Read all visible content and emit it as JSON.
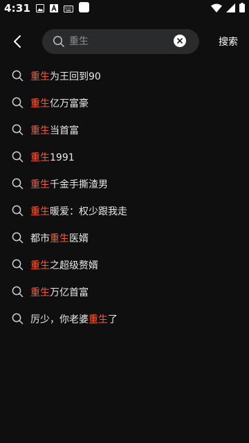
{
  "status_bar": {
    "time": "4:31",
    "icons": [
      "image-icon",
      "text-a-icon",
      "keyboard-icon",
      "app-square-icon",
      "wifi-icon",
      "signal-icon",
      "battery-icon"
    ]
  },
  "header": {
    "back_icon": "chevron-left-icon",
    "search": {
      "value": "重生",
      "placeholder": "重生",
      "icon": "search-icon",
      "clear_icon": "close-icon"
    },
    "search_button_label": "搜索"
  },
  "suggestions": [
    {
      "pre": "",
      "hl": "重生",
      "post": "为王回到90"
    },
    {
      "pre": "",
      "hl": "重生",
      "post": "亿万富豪"
    },
    {
      "pre": "",
      "hl": "重生",
      "post": "当首富"
    },
    {
      "pre": "",
      "hl": "重生",
      "post": "1991"
    },
    {
      "pre": "",
      "hl": "重生",
      "post": "千金手撕渣男"
    },
    {
      "pre": "",
      "hl": "重生",
      "post": "暖爱：权少跟我走"
    },
    {
      "pre": "都市",
      "hl": "重生",
      "post": "医婿"
    },
    {
      "pre": "",
      "hl": "重生",
      "post": "之超级赘婿"
    },
    {
      "pre": "",
      "hl": "重生",
      "post": "万亿首富"
    },
    {
      "pre": "厉少，你老婆",
      "hl": "重生",
      "post": "了"
    }
  ],
  "colors": {
    "background": "#0f0f10",
    "search_box": "#2a2b2d",
    "highlight": "#ff5a2c",
    "text": "#e8e8e8"
  }
}
